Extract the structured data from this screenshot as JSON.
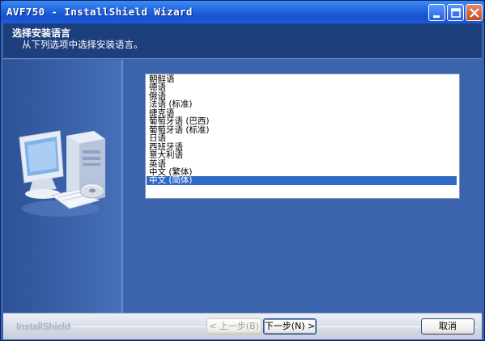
{
  "window": {
    "title": "AVF750 - InstallShield Wizard",
    "controls": [
      "minimize-icon",
      "maximize-icon",
      "close-icon"
    ]
  },
  "header": {
    "title": "选择安装语言",
    "subtitle": "从下列选项中选择安装语言。"
  },
  "languages": {
    "items": [
      "朝鲜语",
      "德语",
      "俄语",
      "法语 (标准)",
      "捷克语",
      "葡萄牙语 (巴西)",
      "葡萄牙语 (标准)",
      "日语",
      "西班牙语",
      "意大利语",
      "英语",
      "中文 (繁体)",
      "中文 (简体)"
    ],
    "selected_index": 12
  },
  "footer": {
    "brand": "InstallShield",
    "back_label": "< 上一步(B)",
    "next_label": "下一步(N) >",
    "cancel_label": "取消"
  },
  "colors": {
    "accent": "#316ac5",
    "header_bg": "#1d3f7d",
    "body_bg": "#3c64ac"
  }
}
